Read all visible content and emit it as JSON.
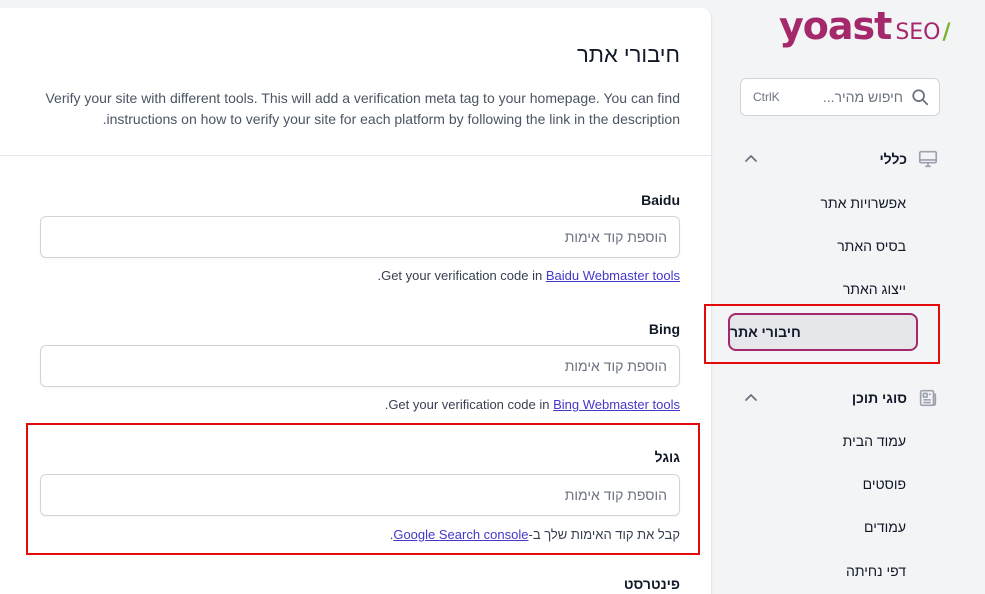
{
  "brand": {
    "name": "yoast",
    "suffix": "SEO",
    "slash": "/",
    "primary_color": "#a4286a",
    "accent_color": "#77b227"
  },
  "search": {
    "placeholder": "חיפוש מהיר...",
    "shortcut": "CtrlK",
    "icon": "search-icon"
  },
  "sidebar": {
    "sections": [
      {
        "label": "כללי",
        "icon": "desktop-icon",
        "expanded": true,
        "items": [
          {
            "label": "אפשרויות אתר",
            "active": false
          },
          {
            "label": "בסיס האתר",
            "active": false
          },
          {
            "label": "ייצוג האתר",
            "active": false
          },
          {
            "label": "חיבורי אתר",
            "active": true
          }
        ]
      },
      {
        "label": "סוגי תוכן",
        "icon": "newspaper-icon",
        "expanded": true,
        "items": [
          {
            "label": "עמוד הבית",
            "active": false
          },
          {
            "label": "פוסטים",
            "active": false
          },
          {
            "label": "עמודים",
            "active": false
          },
          {
            "label": "דפי נחיתה",
            "active": false
          }
        ]
      }
    ]
  },
  "main": {
    "title": "חיבורי אתר",
    "description": "Verify your site with different tools. This will add a verification meta tag to your homepage. You can find instructions on how to verify your site for each platform by following the link in the description.",
    "fields": [
      {
        "label": "Baidu",
        "value": "",
        "placeholder": "הוספת קוד אימות",
        "help_prefix": "Get your verification code in ",
        "help_link": "Baidu Webmaster tools",
        "help_suffix": "."
      },
      {
        "label": "Bing",
        "value": "",
        "placeholder": "הוספת קוד אימות",
        "help_prefix": "Get your verification code in ",
        "help_link": "Bing Webmaster tools",
        "help_suffix": "."
      },
      {
        "label": "גוגל",
        "value": "",
        "placeholder": "הוספת קוד אימות",
        "help_prefix": "קבל את קוד האימות שלך ב-",
        "help_link": "Google Search console",
        "help_suffix": "."
      },
      {
        "label": "פינטרסט"
      }
    ]
  },
  "highlight_color": "#e30a0a"
}
